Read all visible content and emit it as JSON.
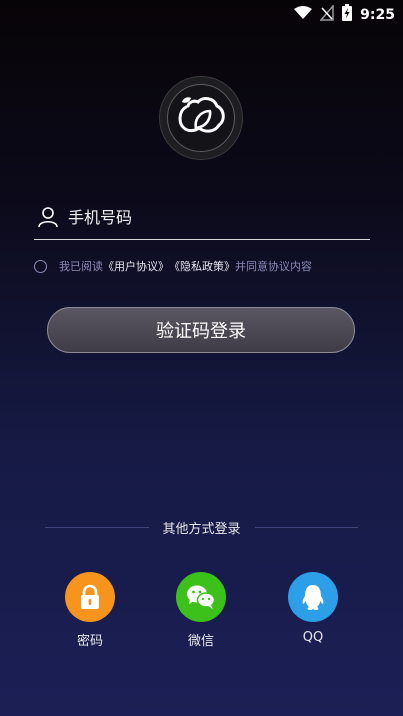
{
  "status_bar": {
    "time": "9:25",
    "icons": [
      "wifi-icon",
      "signal-off-icon",
      "battery-charging-icon"
    ]
  },
  "logo": {
    "icon": "cloud-leaf-logo"
  },
  "phone_field": {
    "placeholder": "手机号码",
    "value": "",
    "icon": "user-icon"
  },
  "agreement": {
    "prefix": "我已阅读",
    "user_agreement": "《用户协议》",
    "privacy_policy": "《隐私政策》",
    "suffix": "并同意协议内容",
    "checked": false
  },
  "login_button": {
    "label": "验证码登录"
  },
  "other_methods": {
    "title": "其他方式登录",
    "items": [
      {
        "label": "密码",
        "icon": "lock-icon",
        "color": "#f7941d"
      },
      {
        "label": "微信",
        "icon": "wechat-icon",
        "color": "#3cc01a"
      },
      {
        "label": "QQ",
        "icon": "qq-icon",
        "color": "#2d9ee8"
      }
    ]
  }
}
